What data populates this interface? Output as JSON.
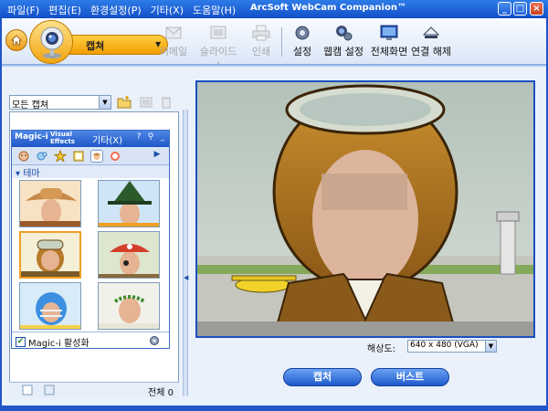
{
  "app": {
    "title": "ArcSoft WebCam Companion™",
    "menu": [
      "파일(F)",
      "편집(E)",
      "환경설정(P)",
      "기타(X)",
      "도움말(H)"
    ]
  },
  "toolbar": {
    "capture_label": "캡쳐",
    "items": [
      {
        "label": "이메일",
        "icon": "email-icon",
        "enabled": false
      },
      {
        "label": "슬라이드 쇼",
        "icon": "slideshow-icon",
        "enabled": false
      },
      {
        "label": "인쇄",
        "icon": "print-icon",
        "enabled": false
      },
      {
        "label": "설정",
        "icon": "settings-icon",
        "enabled": true
      },
      {
        "label": "웹캠 설정",
        "icon": "webcam-settings-icon",
        "enabled": true
      },
      {
        "label": "전체화면",
        "icon": "fullscreen-icon",
        "enabled": true
      },
      {
        "label": "연결 해제",
        "icon": "disconnect-icon",
        "enabled": true
      }
    ]
  },
  "left_panel": {
    "filter_value": "모든 캡쳐",
    "count_label": "전체 0"
  },
  "magic": {
    "logo": "Magic-i",
    "logo_sub": "Visual Effects",
    "other_label": "기타(X)",
    "theme_label": "테마",
    "enable_label": "Magic-i 활성화",
    "enable_checked": true,
    "thumbnails": [
      "cowboy-hat",
      "witch-hat",
      "aviator-helmet",
      "pirate-hat",
      "football-helmet",
      "laurel-wreath"
    ]
  },
  "capture": {
    "resolution_label": "해상도:",
    "resolution_value": "640 x 480 (VGA)",
    "capture_button": "캡처",
    "burst_button": "버스트"
  },
  "colors": {
    "accent": "#1f55c9",
    "tab_orange": "#f29d00"
  }
}
